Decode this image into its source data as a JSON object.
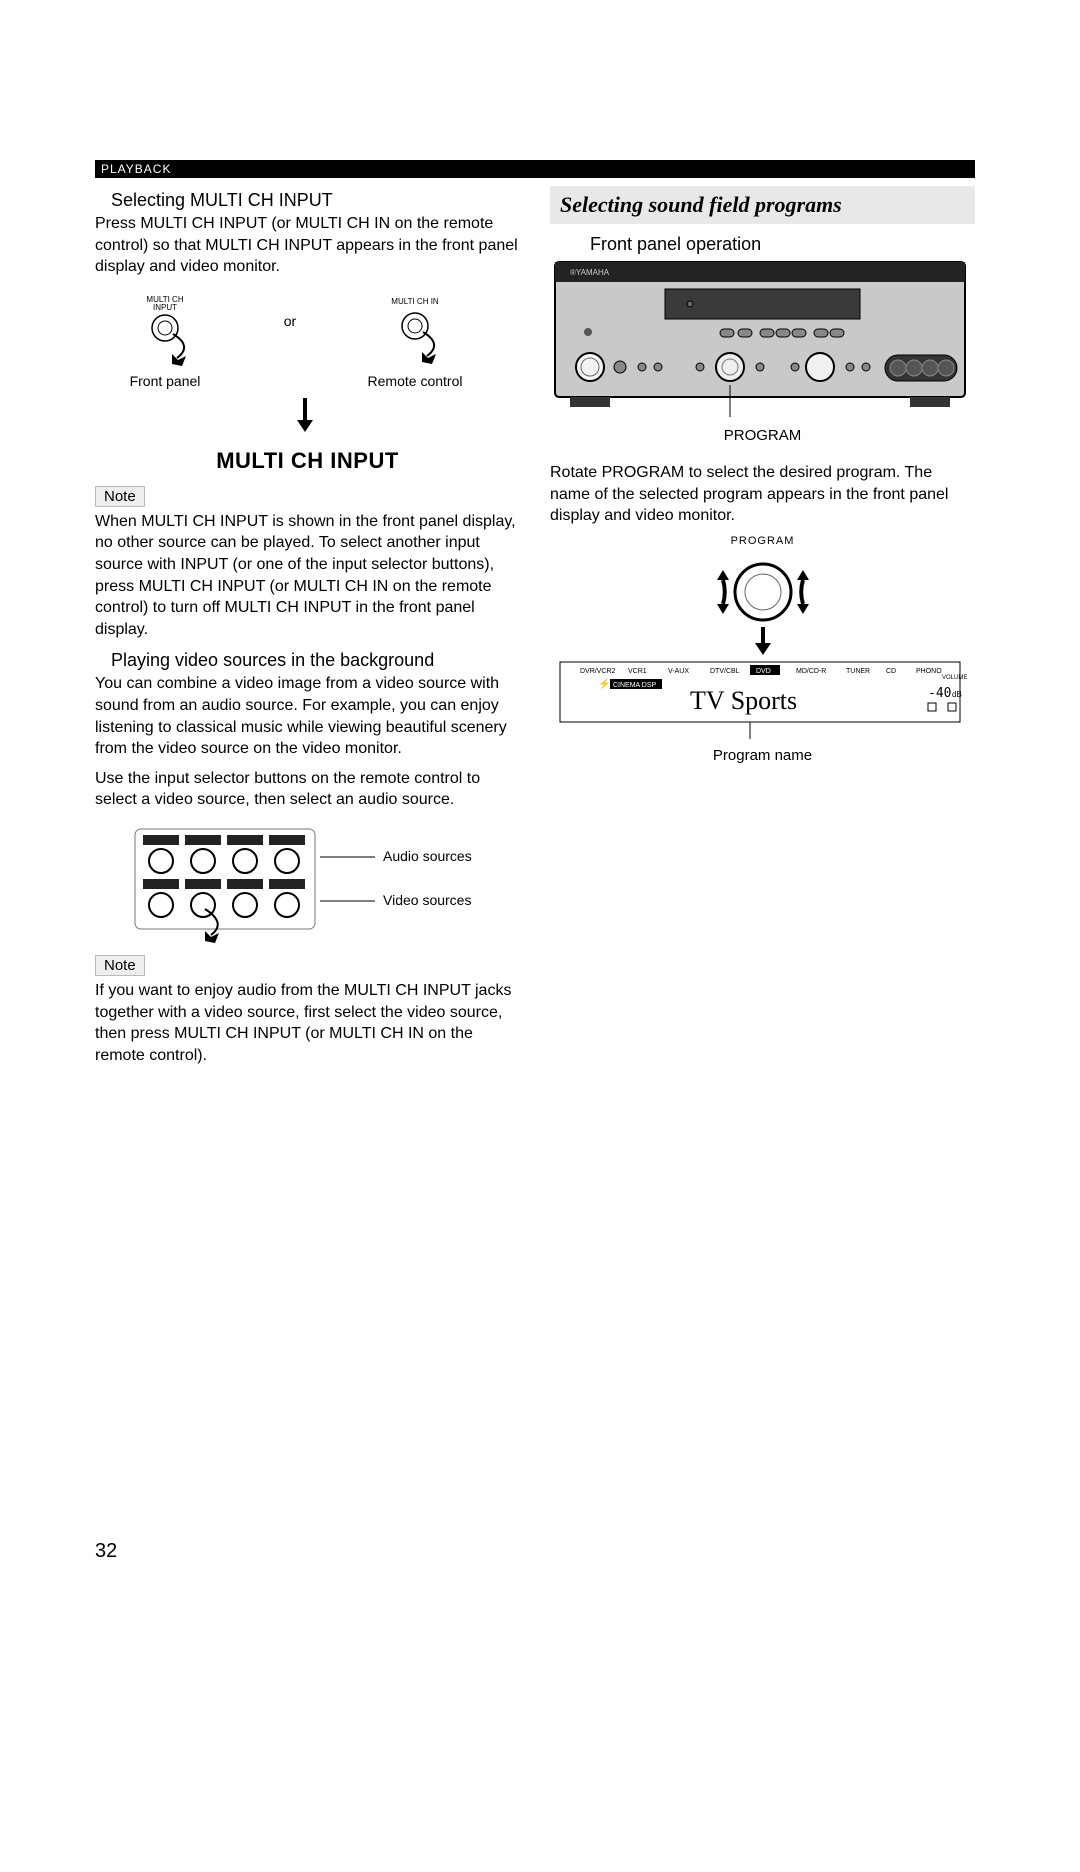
{
  "section_header": "PLAYBACK",
  "left": {
    "sub1_title": "Selecting MULTI CH INPUT",
    "sub1_body": "Press MULTI CH INPUT (or MULTI CH IN on the remote control) so that  MULTI CH INPUT  appears in the front panel display and video monitor.",
    "dial_label_left": "MULTI CH\nINPUT",
    "dial_label_right": "MULTI CH IN",
    "or": "or",
    "front_panel": "Front panel",
    "remote_control": "Remote control",
    "multich_display": "MULTI CH INPUT",
    "note_label": "Note",
    "note1_body": "When  MULTI CH INPUT  is shown in the front panel display, no other source can be played. To select another input source with INPUT (or one of the input selector buttons), press MULTI CH INPUT (or MULTI CH IN on the remote control) to turn off  MULTI CH INPUT  in the front panel display.",
    "sub2_title": "Playing video sources in the background",
    "sub2_body": "You can combine a video image from a video source with sound from an audio source. For example, you can enjoy listening to classical music while viewing beautiful scenery from the video source on the video monitor.",
    "sub2_body2": "Use the input selector buttons on the remote control to select a video source, then select an audio source.",
    "audio_sources": "Audio sources",
    "video_sources": "Video sources",
    "note2_body": "If you want to enjoy audio from the MULTI CH INPUT jacks together with a video source, first select the video source, then press MULTI CH INPUT (or MULTI CH IN on the remote control)."
  },
  "right": {
    "title": "Selecting sound field programs",
    "front_panel_op": "Front panel operation",
    "program_label": "PROGRAM",
    "rotate_text": "Rotate PROGRAM to select the desired program. The name of the selected program appears in the front panel display and video monitor.",
    "program_small": "PROGRAM",
    "display_sources": [
      "DVR/VCR2",
      "VCR1",
      "V-AUX",
      "DTV/CBL",
      "DVD",
      "MD/CD-R",
      "TUNER",
      "CD",
      "PHONO"
    ],
    "display_text": "TV Sports",
    "program_name": "Program name"
  },
  "page_number": "32"
}
